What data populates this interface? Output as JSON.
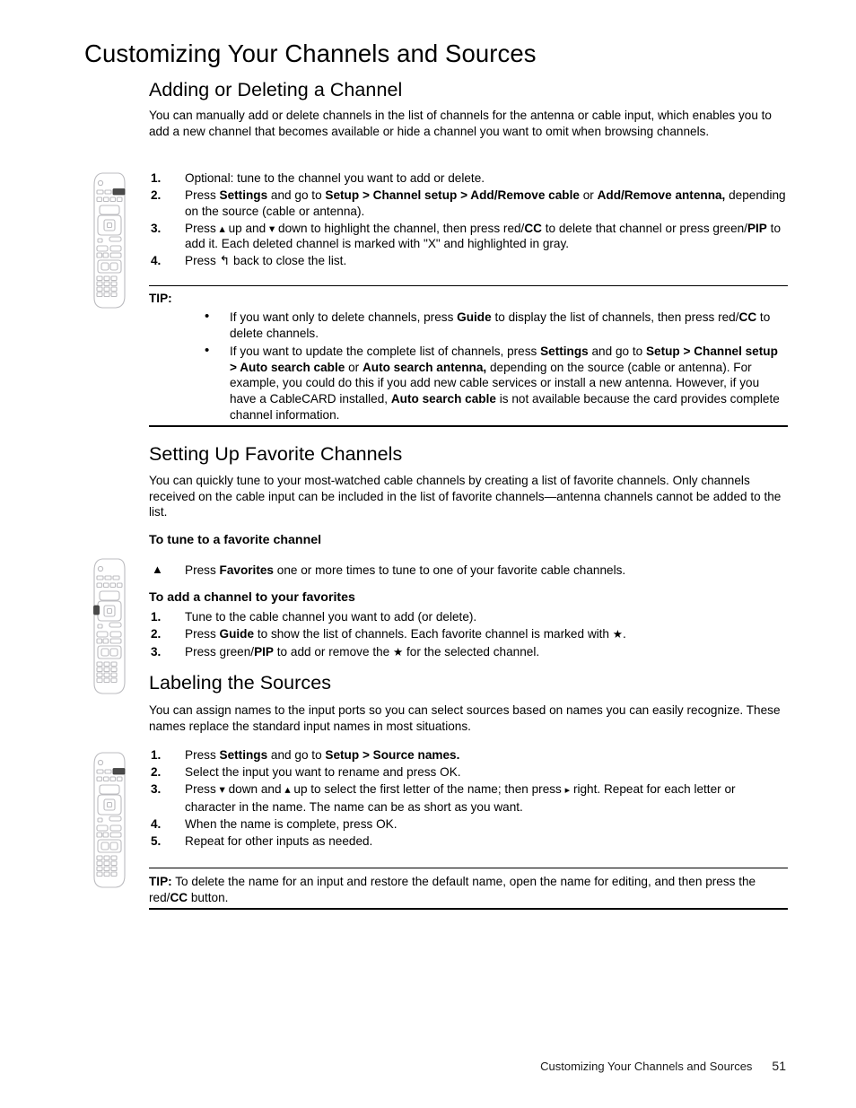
{
  "page": {
    "title": "Customizing Your Channels and Sources",
    "footer_text": "Customizing Your Channels and Sources",
    "page_number": "51"
  },
  "glyphs": {
    "up": "▴",
    "down": "▾",
    "right": "▸",
    "back": "↰",
    "star": "★",
    "triangle_bullet": "▲",
    "bullet_dot": "•"
  },
  "sections": [
    {
      "id": "adding-deleting",
      "heading": "Adding or Deleting a Channel",
      "intro": "You can manually add or delete channels in the list of channels for the antenna or cable input, which enables you to add a new channel that becomes available or hide a channel you want to omit when browsing channels.",
      "steps": [
        {
          "num": "1.",
          "text": "Optional: tune to the channel you want to add or delete."
        },
        {
          "num": "2.",
          "text": "Press Settings and go to Setup > Channel setup > Add/Remove cable or Add/Remove antenna, depending on the source (cable or antenna)."
        },
        {
          "num": "3.",
          "text": "Press ▴ up and ▾ down to highlight the channel, then press red/CC to delete that channel or press green/PIP to add it. Each deleted channel is marked with \"X\" and highlighted in gray."
        },
        {
          "num": "4.",
          "text": "Press ↰ back to close the list."
        }
      ],
      "tip": {
        "label": "TIP:",
        "bullets": [
          "If you want only to delete channels, press Guide to display the list of channels, then press red/CC to delete channels.",
          "If you want to update the complete list of channels, press Settings and go to Setup > Channel setup > Auto search cable or Auto search antenna, depending on the source (cable or antenna). For example, you could do this if you add new cable services or install a new antenna. However, if you have a CableCARD installed, Auto search cable is not available because the card provides complete channel information."
        ]
      }
    },
    {
      "id": "favorite-channels",
      "heading": "Setting Up Favorite Channels",
      "intro": "You can quickly tune to your most-watched cable channels by creating a list of favorite channels. Only channels received on the cable input can be included in the list of favorite channels—antenna channels cannot be added to the list.",
      "sub1_heading": "To tune to a favorite channel",
      "sub1_step": "Press Favorites one or more times to tune to one of your favorite cable channels.",
      "sub2_heading": "To add a channel to your favorites",
      "sub2_steps": [
        {
          "num": "1.",
          "text": "Tune to the cable channel you want to add (or delete)."
        },
        {
          "num": "2.",
          "text": "Press Guide to show the list of channels. Each favorite channel is marked with ★."
        },
        {
          "num": "3.",
          "text": "Press green/PIP to add or remove the ★ for the selected channel."
        }
      ]
    },
    {
      "id": "labeling-sources",
      "heading": "Labeling the Sources",
      "intro": "You can assign names to the input ports so you can select sources based on names you can easily recognize. These names replace the standard input names in most situations.",
      "steps": [
        {
          "num": "1.",
          "text": "Press Settings and go to Setup > Source names."
        },
        {
          "num": "2.",
          "text": "Select the input you want to rename and press OK."
        },
        {
          "num": "3.",
          "text": "Press ▾ down and ▴ up to select the first letter of the name; then press ▸ right. Repeat for each letter or character in the name. The name can be as short as you want."
        },
        {
          "num": "4.",
          "text": "When the name is complete, press OK."
        },
        {
          "num": "5.",
          "text": "Repeat for other inputs as needed."
        }
      ],
      "tip": {
        "label": "TIP:",
        "text": "To delete the name for an input and restore the default name, open the name for editing, and then press the red/CC button."
      }
    }
  ],
  "illustrations": [
    {
      "id": "remote-settings-top",
      "name": "remote-control-settings-button",
      "highlight": "top-right"
    },
    {
      "id": "remote-favorites",
      "name": "remote-control-favorites-button",
      "highlight": "left-side"
    },
    {
      "id": "remote-settings-top-2",
      "name": "remote-control-settings-button",
      "highlight": "top-right"
    }
  ],
  "colors": {
    "text": "#000000",
    "page_background": "#ffffff",
    "remote_outline": "#b8b8bc",
    "remote_highlight": "#4a4a4a"
  }
}
